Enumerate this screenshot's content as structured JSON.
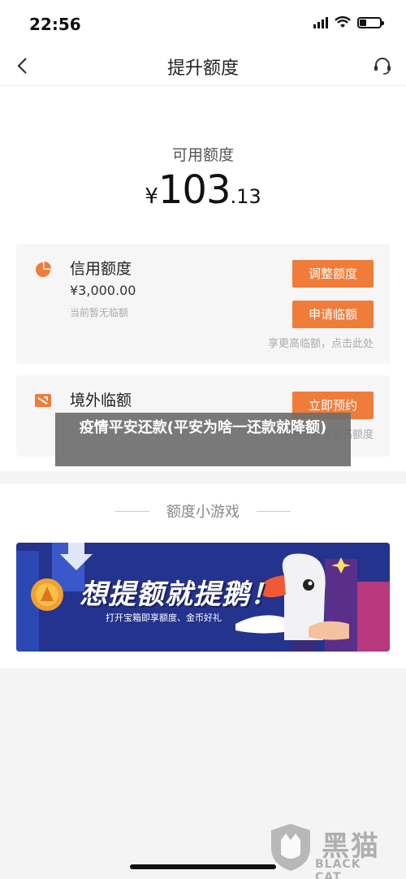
{
  "status_bar": {
    "time": "22:56",
    "battery_level": 0.35
  },
  "nav": {
    "title": "提升额度",
    "back_icon": "chevron-left-icon",
    "service_icon": "headset-icon"
  },
  "available": {
    "label": "可用额度",
    "currency": "¥",
    "integer": "103",
    "decimal": ".13"
  },
  "credit_card": {
    "icon": "pie-chart-icon",
    "title": "信用额度",
    "amount": "¥3,000.00",
    "sub": "当前暂无临额",
    "adjust_button": "调整额度",
    "temp_button": "申请临额",
    "hint": "享更高临额，点击此处"
  },
  "overseas_card": {
    "icon": "airplane-icon",
    "title": "境外临额",
    "reserve_button": "立即预约",
    "hint": "境外出游享更高额度"
  },
  "overlay": {
    "caption": "疫情平安还款(平安为啥一还款就降额)"
  },
  "games": {
    "title": "额度小游戏",
    "banner": {
      "headline": "想提额就提鹅！",
      "subtext": "打开宝箱即享额度、金币好礼"
    }
  },
  "watermark": {
    "cn": "黑猫",
    "en": "BLACK CAT"
  },
  "colors": {
    "accent": "#f07c3a",
    "banner_bg": "#24338e"
  }
}
